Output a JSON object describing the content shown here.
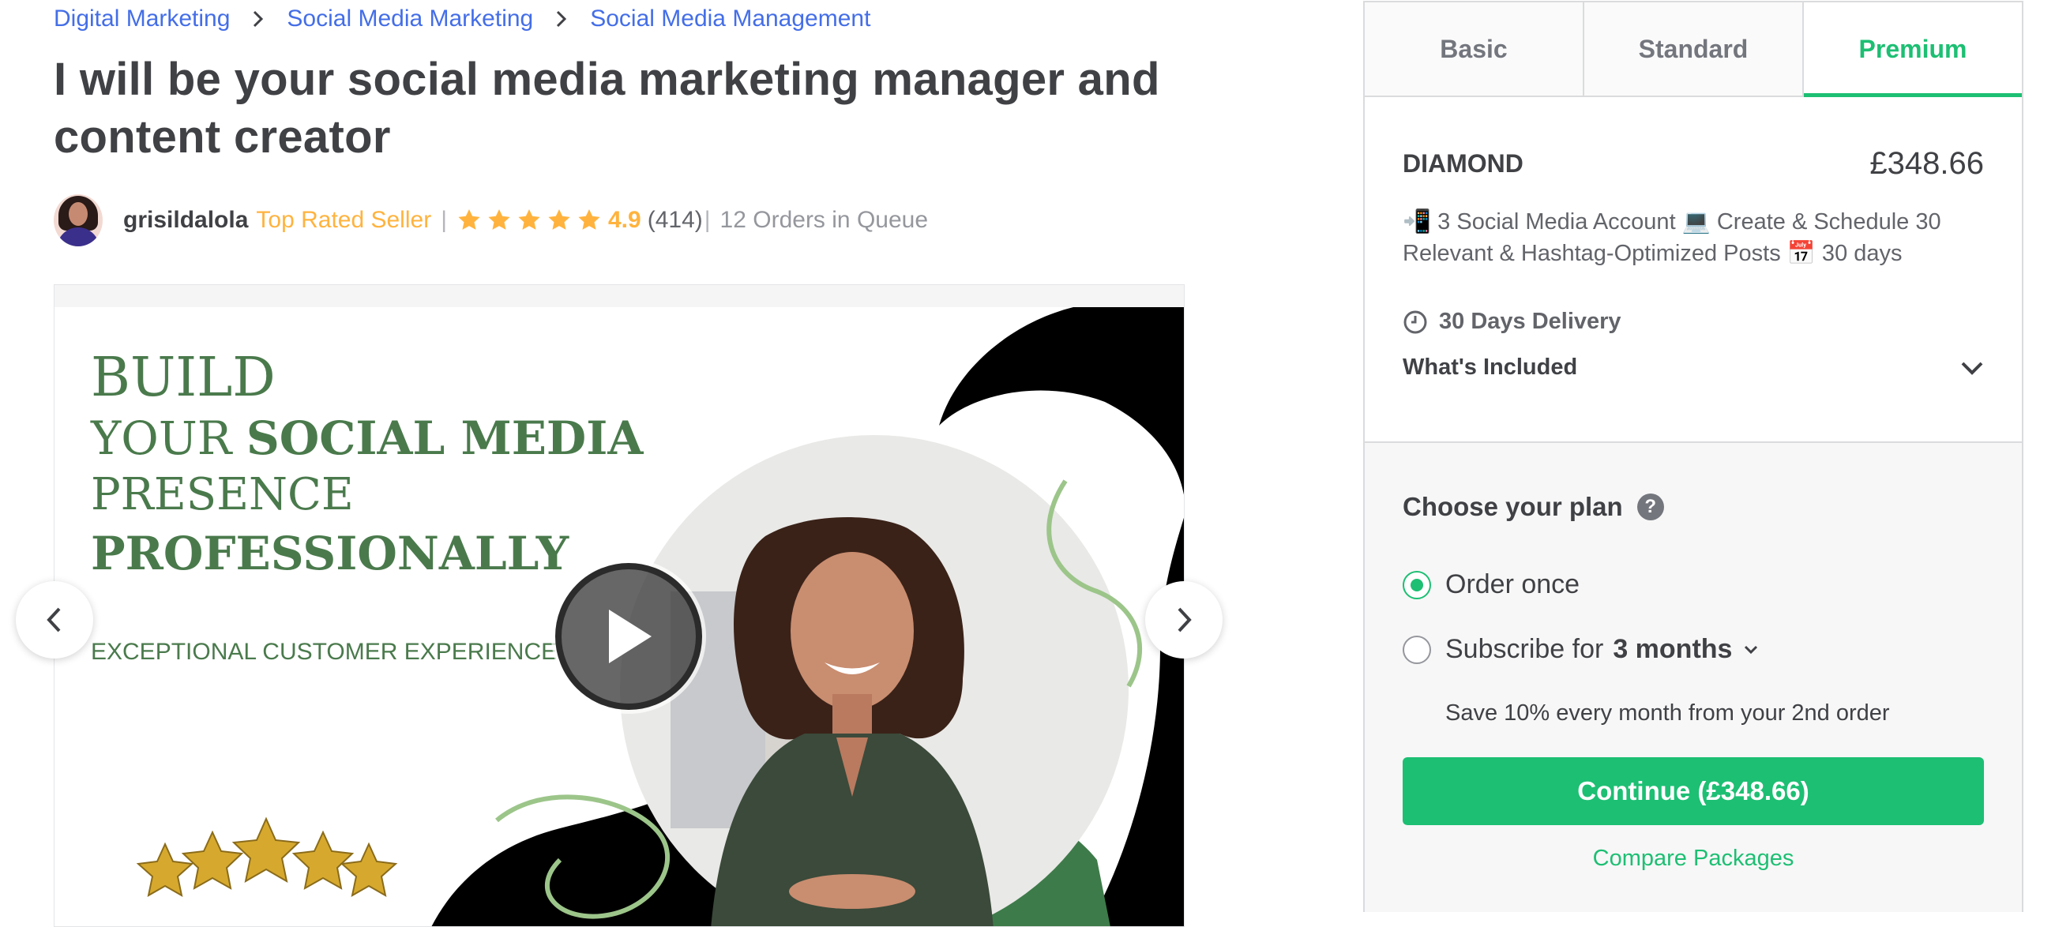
{
  "breadcrumb": {
    "items": [
      "Digital Marketing",
      "Social Media Marketing",
      "Social Media Management"
    ]
  },
  "gig": {
    "title": "I will be your social media marketing manager and content creator"
  },
  "seller": {
    "name": "grisildalola",
    "badge": "Top Rated Seller",
    "rating": "4.9",
    "rating_value": 4.9,
    "reviews": "(414)",
    "queue": "12 Orders in Queue"
  },
  "gallery": {
    "lines": {
      "line1": "BUILD",
      "line2a": "YOUR ",
      "line2b": "SOCIAL MEDIA",
      "line3": "PRESENCE",
      "line4": "PROFESSIONALLY",
      "line5": "EXCEPTIONAL CUSTOMER EXPERIENCE"
    },
    "accent_color": "#4a7a4c"
  },
  "package_tabs": [
    "Basic",
    "Standard",
    "Premium"
  ],
  "active_tab": "Premium",
  "package": {
    "name": "DIAMOND",
    "price": "£348.66",
    "description": "📲 3 Social Media Account 💻 Create & Schedule 30 Relevant & Hashtag-Optimized Posts 📅 30 days",
    "delivery": "30 Days Delivery",
    "included_label": "What's Included"
  },
  "plan": {
    "title": "Choose your plan",
    "order_once": "Order once",
    "subscribe_label": "Subscribe for",
    "subscribe_period": "3 months",
    "save_note": "Save 10% every month from your 2nd order",
    "continue_label": "Continue (£348.66)",
    "compare_label": "Compare Packages",
    "selected": "order_once"
  },
  "colors": {
    "brand_green": "#1dbf73",
    "link_blue": "#446ee7",
    "star_gold": "#ffb33e"
  },
  "icons": [
    "chevron-right-icon",
    "star-icon",
    "play-icon",
    "chevron-left-icon",
    "clock-icon",
    "chevron-down-icon",
    "help-icon"
  ]
}
